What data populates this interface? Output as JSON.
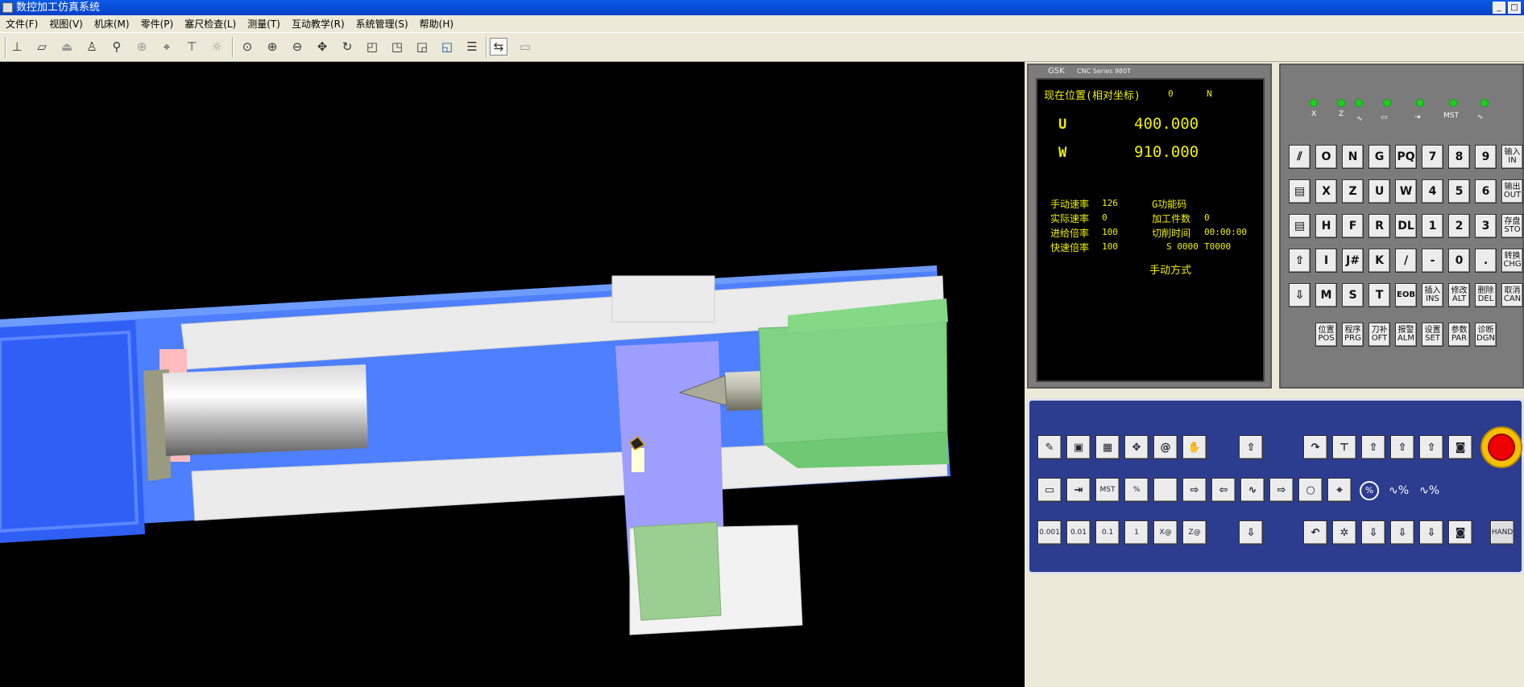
{
  "window": {
    "title": "数控加工仿真系统",
    "min": "_",
    "max": "□"
  },
  "menu": [
    "文件(F)",
    "视图(V)",
    "机床(M)",
    "零件(P)",
    "塞尺检查(L)",
    "测量(T)",
    "互动教学(R)",
    "系统管理(S)",
    "帮助(H)"
  ],
  "panel": {
    "brand": "GSK",
    "series": "CNC Series 980T"
  },
  "screen": {
    "title": "现在位置(相对坐标)",
    "o": "0",
    "n": "N",
    "u_label": "U",
    "u_value": "400.000",
    "w_label": "W",
    "w_value": "910.000",
    "manual_rate_label": "手动速率",
    "manual_rate": "126",
    "g_label": "G功能码",
    "actual_rate_label": "实际速率",
    "actual_rate": "0",
    "parts_label": "加工件数",
    "parts": "0",
    "feed_ovr_label": "进给倍率",
    "feed_ovr": "100",
    "cut_time_label": "切削时间",
    "cut_time": "00:00:00",
    "rapid_ovr_label": "快速倍率",
    "rapid_ovr": "100",
    "s_value": "S 0000",
    "t_value": "T0000",
    "mode": "手动方式"
  },
  "leds": {
    "x": "X",
    "z": "Z",
    "mst": "MST"
  },
  "keys": {
    "r1": [
      "O",
      "N",
      "G",
      "PQ",
      "7",
      "8",
      "9",
      "输入IN"
    ],
    "r2": [
      "X",
      "Z",
      "U",
      "W",
      "4",
      "5",
      "6",
      "输出OUT"
    ],
    "r3": [
      "H",
      "F",
      "R",
      "DL",
      "1",
      "2",
      "3",
      "存盘STO"
    ],
    "r4": [
      "I",
      "J#",
      "K",
      "/",
      "-",
      "0",
      ".",
      "转换CHG"
    ],
    "r5": [
      "M",
      "S",
      "T",
      "EOB",
      "插入INS",
      "修改ALT",
      "删除DEL",
      "取消CAN"
    ],
    "func": [
      "位置POS",
      "程序PRG",
      "刀补OFT",
      "报警ALM",
      "设置SET",
      "参数PAR",
      "诊断DGN"
    ]
  },
  "ctrl": {
    "mst": "MST",
    "inc": [
      "0.001",
      "0.01",
      "0.1",
      "1"
    ],
    "xzero": "X@",
    "zzero": "Z@",
    "hand": "HAND",
    "pct1": "%",
    "pct2": "%",
    "zminus": "Z"
  },
  "colors": {
    "title_bar": "#0a4fd8",
    "panel_blue": "#2c3c8f",
    "screen_text": "#f0f000",
    "bed_blue": "#4d7fff"
  }
}
